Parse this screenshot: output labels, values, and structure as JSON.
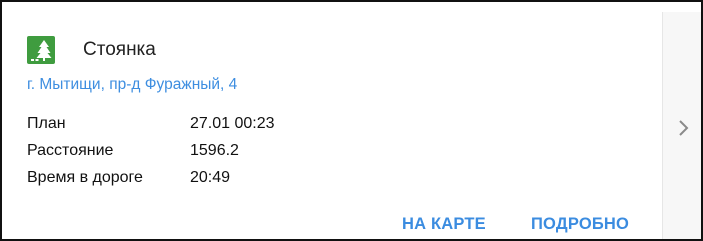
{
  "card": {
    "title": "Стоянка",
    "icon": "parking-trees-icon",
    "icon_color": "#3f9c3f",
    "address": "г. Мытищи, пр-д Фуражный, 4",
    "address_color": "#3e8ee0",
    "details": [
      {
        "label": "План",
        "value": "27.01 00:23"
      },
      {
        "label": "Расстояние",
        "value": "1596.2"
      },
      {
        "label": "Время в дороге",
        "value": "20:49"
      }
    ],
    "actions": {
      "on_map": "НА КАРТЕ",
      "details": "ПОДРОБНО"
    },
    "action_color": "#3b8ce0"
  },
  "side": {
    "icon": "chevron-right-icon"
  }
}
